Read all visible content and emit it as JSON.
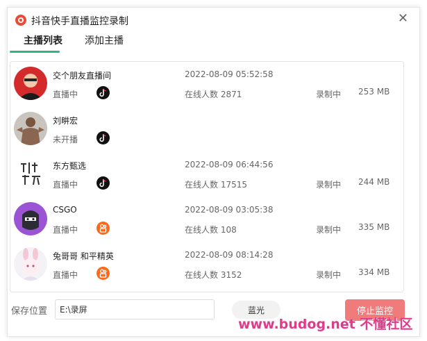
{
  "window": {
    "title": "抖音快手直播监控录制",
    "close_glyph": "✕"
  },
  "tabs": [
    {
      "label": "主播列表",
      "active": true
    },
    {
      "label": "添加主播",
      "active": false
    }
  ],
  "streamers": [
    {
      "name": "交个朋友直播间",
      "status": "直播中",
      "platform": "douyin",
      "platform_icon": "tiktok-icon",
      "time": "2022-08-09 05:52:58",
      "viewers": "在线人数 2871",
      "recording": "录制中",
      "size": "253 MB"
    },
    {
      "name": "刘畊宏",
      "status": "未开播",
      "platform": "douyin",
      "platform_icon": "tiktok-icon",
      "time": "",
      "viewers": "",
      "recording": "",
      "size": ""
    },
    {
      "name": "东方甄选",
      "status": "直播中",
      "platform": "douyin",
      "platform_icon": "tiktok-icon",
      "time": "2022-08-09 06:44:56",
      "viewers": "在线人数 17515",
      "recording": "录制中",
      "size": "244 MB"
    },
    {
      "name": "CSGO",
      "status": "直播中",
      "platform": "kuaishou",
      "platform_icon": "kuaishou-icon",
      "time": "2022-08-09 03:05:38",
      "viewers": "在线人数 108",
      "recording": "录制中",
      "size": "335 MB"
    },
    {
      "name": "兔哥哥 和平精英",
      "status": "直播中",
      "platform": "kuaishou",
      "platform_icon": "kuaishou-icon",
      "time": "2022-08-09 08:14:28",
      "viewers": "在线人数 3152",
      "recording": "录制中",
      "size": "334 MB"
    }
  ],
  "footer": {
    "save_label": "保存位置",
    "save_path": "E:\\录屏",
    "quality_label": "蓝光",
    "stop_label": "停止监控"
  },
  "watermark": "www.budog.net 不懂社区",
  "colors": {
    "accent": "#32b47f",
    "stop": "#f07b7b",
    "app_icon": "#ea4a37",
    "watermark": "#e03b8b"
  }
}
